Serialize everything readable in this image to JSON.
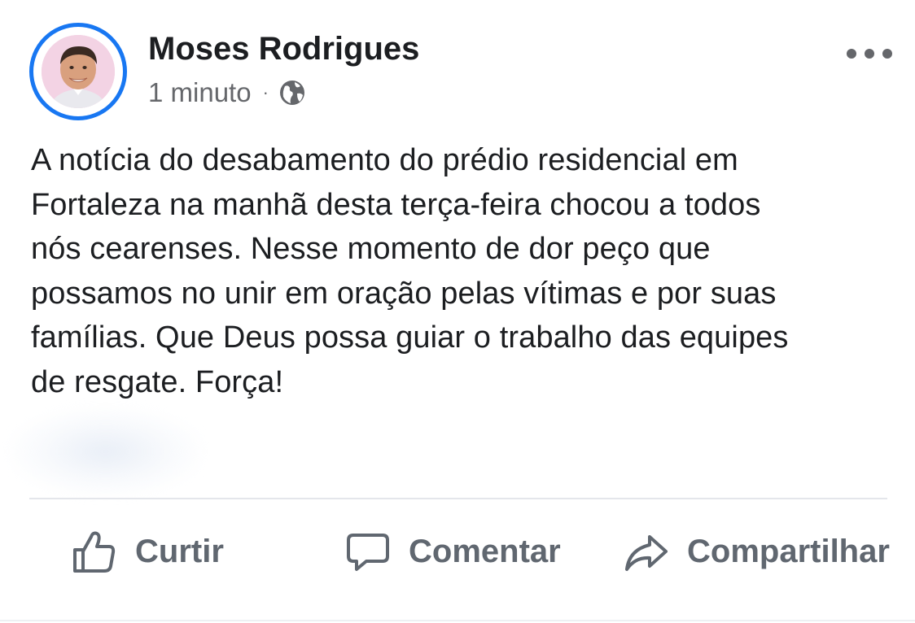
{
  "post": {
    "author": "Moses Rodrigues",
    "timestamp": "1 minuto",
    "separator": "·",
    "privacy_icon": "globe-icon",
    "more_icon": "more-options-icon",
    "text": "A notícia do desabamento do prédio residencial em\nFortaleza na manhã desta terça-feira chocou a todos\nnós cearenses. Nesse momento de dor peço que\npossamos no unir em oração pelas vítimas e por suas\nfamílias. Que Deus possa guiar o trabalho das equipes\nde resgate. Força!"
  },
  "actions": {
    "like": {
      "label": "Curtir",
      "icon": "thumbs-up-icon"
    },
    "comment": {
      "label": "Comentar",
      "icon": "comment-bubble-icon"
    },
    "share": {
      "label": "Compartilhar",
      "icon": "share-arrow-icon"
    }
  },
  "colors": {
    "avatar_ring": "#1877f2",
    "text_primary": "#1c1e21",
    "text_secondary": "#65676b",
    "action_text": "#606770",
    "divider": "#e4e6eb"
  }
}
